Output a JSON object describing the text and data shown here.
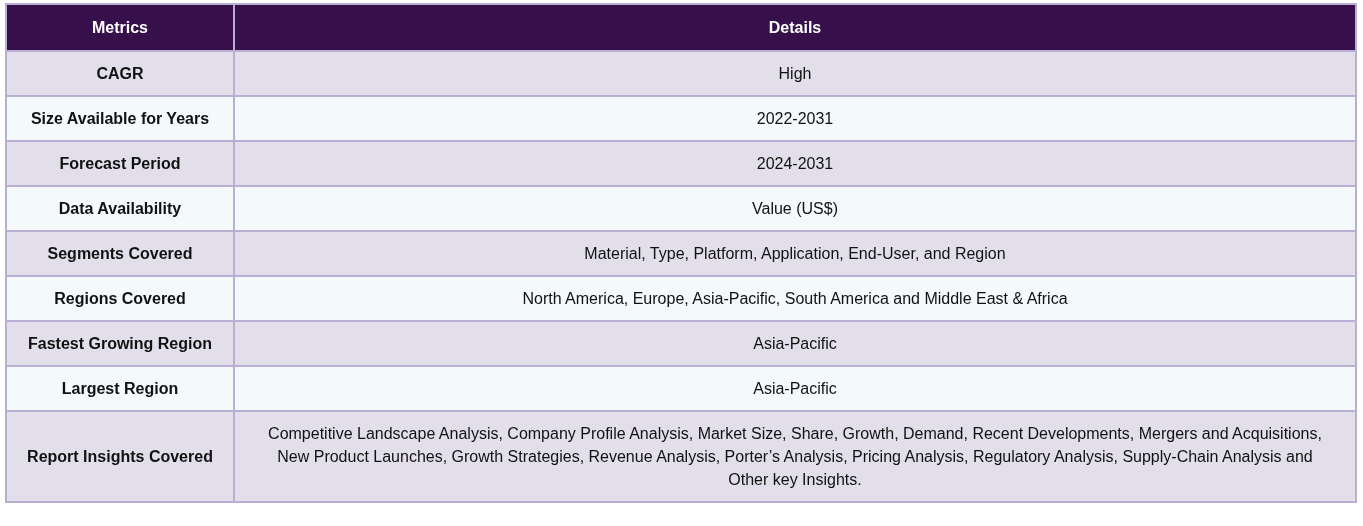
{
  "table": {
    "columns": [
      "Metrics",
      "Details"
    ],
    "rows": [
      {
        "metric": "CAGR",
        "detail": "High"
      },
      {
        "metric": "Size Available for Years",
        "detail": "2022-2031"
      },
      {
        "metric": "Forecast Period",
        "detail": "2024-2031"
      },
      {
        "metric": "Data Availability",
        "detail": "Value (US$)"
      },
      {
        "metric": "Segments Covered",
        "detail": "Material, Type, Platform, Application, End-User, and Region"
      },
      {
        "metric": "Regions Covered",
        "detail": "North America, Europe, Asia-Pacific, South America and Middle East & Africa"
      },
      {
        "metric": "Fastest Growing Region",
        "detail": "Asia-Pacific"
      },
      {
        "metric": "Largest Region",
        "detail": "Asia-Pacific"
      },
      {
        "metric": "Report Insights Covered",
        "detail": "Competitive Landscape Analysis, Company Profile Analysis, Market Size, Share, Growth, Demand, Recent Developments, Mergers and Acquisitions, New Product Launches, Growth Strategies, Revenue Analysis, Porter’s Analysis, Pricing Analysis, Regulatory Analysis, Supply-Chain Analysis and Other key Insights."
      }
    ]
  }
}
